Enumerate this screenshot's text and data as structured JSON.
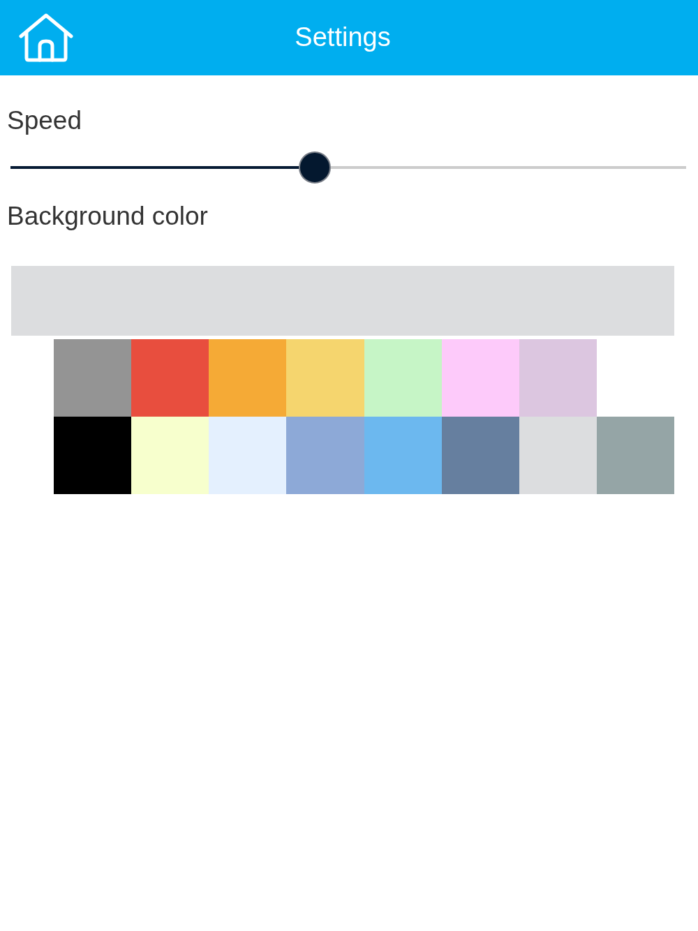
{
  "header": {
    "title": "Settings"
  },
  "speed": {
    "label": "Speed",
    "level": 0.45
  },
  "background_color": {
    "label": "Background color",
    "color": "#dcdddf"
  },
  "palette": {
    "rows": [
      {
        "swatches": [
          {
            "color": "#949494"
          },
          {
            "color": "#e84e3e"
          },
          {
            "color": "#f5aa36"
          },
          {
            "color": "#f5d56e"
          },
          {
            "color": "#c6f5c6"
          },
          {
            "color": "#fdcafa"
          },
          {
            "color": "#dcc6e0"
          }
        ]
      },
      {
        "swatches": [
          {
            "color": "#000000"
          },
          {
            "color": "#f7ffcd"
          },
          {
            "color": "#e4f0fe"
          },
          {
            "color": "#8da9d7"
          },
          {
            "color": "#6cb8ef"
          },
          {
            "color": "#667f9f"
          },
          {
            "color": "#dcdddf"
          },
          {
            "color": "#95a5a6"
          }
        ]
      }
    ]
  }
}
